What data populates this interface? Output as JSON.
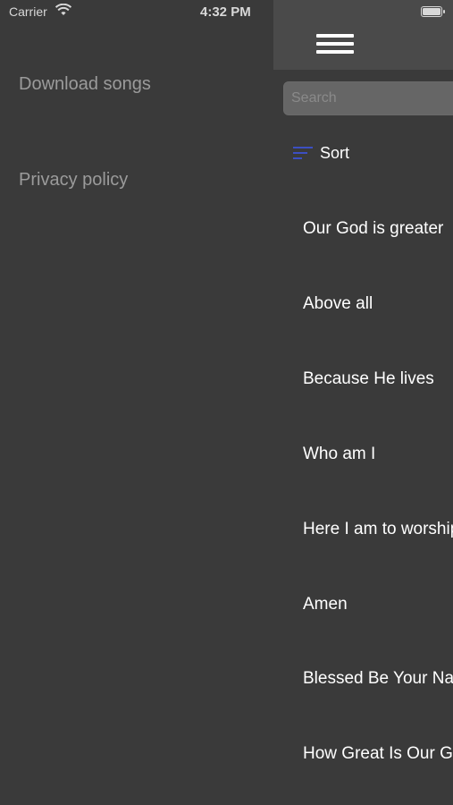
{
  "status_bar": {
    "carrier": "Carrier",
    "time": "4:32 PM"
  },
  "drawer": {
    "items": [
      {
        "label": "Download songs"
      },
      {
        "label": "Privacy policy"
      }
    ]
  },
  "main": {
    "search_placeholder": "Search",
    "sort_label": "Sort",
    "songs": [
      {
        "title": "Our God is greater"
      },
      {
        "title": "Above all"
      },
      {
        "title": "Because He lives"
      },
      {
        "title": "Who am I"
      },
      {
        "title": "Here I am to worship"
      },
      {
        "title": "Amen"
      },
      {
        "title": "Blessed Be Your Name"
      },
      {
        "title": "How Great Is Our God"
      }
    ]
  },
  "colors": {
    "background": "#3a3a3a",
    "header": "#4a4a4a",
    "sort_accent": "#3c4fc2",
    "drawer_text": "#9b9b9b"
  }
}
